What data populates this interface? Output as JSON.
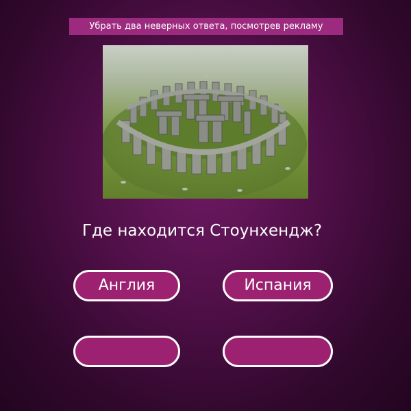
{
  "ad_button": {
    "label": "Убрать два неверных ответа, посмотрев рекламу"
  },
  "image": {
    "subject": "stonehenge-photo"
  },
  "question": {
    "text": "Где находится Стоунхендж?"
  },
  "answers": [
    {
      "label": "Англия"
    },
    {
      "label": "Испания"
    },
    {
      "label": ""
    },
    {
      "label": ""
    }
  ],
  "colors": {
    "background": "#4f0f47",
    "button": "#9c2170",
    "button_border": "#ffffff",
    "ad_button": "#9c2a7e",
    "text": "#ffffff"
  }
}
